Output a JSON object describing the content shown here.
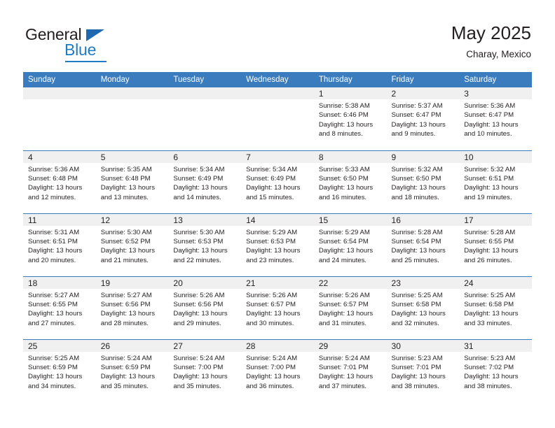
{
  "brand": {
    "name_part1": "General",
    "name_part2": "Blue"
  },
  "header": {
    "title": "May 2025",
    "subtitle": "Charay, Mexico"
  },
  "colors": {
    "header_blue": "#3b7cbf",
    "brand_blue": "#1f7bc4",
    "daynum_bg": "#f0f0f0",
    "text": "#231f20"
  },
  "weekdays": [
    "Sunday",
    "Monday",
    "Tuesday",
    "Wednesday",
    "Thursday",
    "Friday",
    "Saturday"
  ],
  "labels": {
    "sunrise_prefix": "Sunrise:",
    "sunset_prefix": "Sunset:",
    "daylight_prefix": "Daylight:"
  },
  "weeks": [
    [
      {
        "day": "",
        "empty": true
      },
      {
        "day": "",
        "empty": true
      },
      {
        "day": "",
        "empty": true
      },
      {
        "day": "",
        "empty": true
      },
      {
        "day": "1",
        "sunrise": "Sunrise: 5:38 AM",
        "sunset": "Sunset: 6:46 PM",
        "daylight": "Daylight: 13 hours and 8 minutes."
      },
      {
        "day": "2",
        "sunrise": "Sunrise: 5:37 AM",
        "sunset": "Sunset: 6:47 PM",
        "daylight": "Daylight: 13 hours and 9 minutes."
      },
      {
        "day": "3",
        "sunrise": "Sunrise: 5:36 AM",
        "sunset": "Sunset: 6:47 PM",
        "daylight": "Daylight: 13 hours and 10 minutes."
      }
    ],
    [
      {
        "day": "4",
        "sunrise": "Sunrise: 5:36 AM",
        "sunset": "Sunset: 6:48 PM",
        "daylight": "Daylight: 13 hours and 12 minutes."
      },
      {
        "day": "5",
        "sunrise": "Sunrise: 5:35 AM",
        "sunset": "Sunset: 6:48 PM",
        "daylight": "Daylight: 13 hours and 13 minutes."
      },
      {
        "day": "6",
        "sunrise": "Sunrise: 5:34 AM",
        "sunset": "Sunset: 6:49 PM",
        "daylight": "Daylight: 13 hours and 14 minutes."
      },
      {
        "day": "7",
        "sunrise": "Sunrise: 5:34 AM",
        "sunset": "Sunset: 6:49 PM",
        "daylight": "Daylight: 13 hours and 15 minutes."
      },
      {
        "day": "8",
        "sunrise": "Sunrise: 5:33 AM",
        "sunset": "Sunset: 6:50 PM",
        "daylight": "Daylight: 13 hours and 16 minutes."
      },
      {
        "day": "9",
        "sunrise": "Sunrise: 5:32 AM",
        "sunset": "Sunset: 6:50 PM",
        "daylight": "Daylight: 13 hours and 18 minutes."
      },
      {
        "day": "10",
        "sunrise": "Sunrise: 5:32 AM",
        "sunset": "Sunset: 6:51 PM",
        "daylight": "Daylight: 13 hours and 19 minutes."
      }
    ],
    [
      {
        "day": "11",
        "sunrise": "Sunrise: 5:31 AM",
        "sunset": "Sunset: 6:51 PM",
        "daylight": "Daylight: 13 hours and 20 minutes."
      },
      {
        "day": "12",
        "sunrise": "Sunrise: 5:30 AM",
        "sunset": "Sunset: 6:52 PM",
        "daylight": "Daylight: 13 hours and 21 minutes."
      },
      {
        "day": "13",
        "sunrise": "Sunrise: 5:30 AM",
        "sunset": "Sunset: 6:53 PM",
        "daylight": "Daylight: 13 hours and 22 minutes."
      },
      {
        "day": "14",
        "sunrise": "Sunrise: 5:29 AM",
        "sunset": "Sunset: 6:53 PM",
        "daylight": "Daylight: 13 hours and 23 minutes."
      },
      {
        "day": "15",
        "sunrise": "Sunrise: 5:29 AM",
        "sunset": "Sunset: 6:54 PM",
        "daylight": "Daylight: 13 hours and 24 minutes."
      },
      {
        "day": "16",
        "sunrise": "Sunrise: 5:28 AM",
        "sunset": "Sunset: 6:54 PM",
        "daylight": "Daylight: 13 hours and 25 minutes."
      },
      {
        "day": "17",
        "sunrise": "Sunrise: 5:28 AM",
        "sunset": "Sunset: 6:55 PM",
        "daylight": "Daylight: 13 hours and 26 minutes."
      }
    ],
    [
      {
        "day": "18",
        "sunrise": "Sunrise: 5:27 AM",
        "sunset": "Sunset: 6:55 PM",
        "daylight": "Daylight: 13 hours and 27 minutes."
      },
      {
        "day": "19",
        "sunrise": "Sunrise: 5:27 AM",
        "sunset": "Sunset: 6:56 PM",
        "daylight": "Daylight: 13 hours and 28 minutes."
      },
      {
        "day": "20",
        "sunrise": "Sunrise: 5:26 AM",
        "sunset": "Sunset: 6:56 PM",
        "daylight": "Daylight: 13 hours and 29 minutes."
      },
      {
        "day": "21",
        "sunrise": "Sunrise: 5:26 AM",
        "sunset": "Sunset: 6:57 PM",
        "daylight": "Daylight: 13 hours and 30 minutes."
      },
      {
        "day": "22",
        "sunrise": "Sunrise: 5:26 AM",
        "sunset": "Sunset: 6:57 PM",
        "daylight": "Daylight: 13 hours and 31 minutes."
      },
      {
        "day": "23",
        "sunrise": "Sunrise: 5:25 AM",
        "sunset": "Sunset: 6:58 PM",
        "daylight": "Daylight: 13 hours and 32 minutes."
      },
      {
        "day": "24",
        "sunrise": "Sunrise: 5:25 AM",
        "sunset": "Sunset: 6:58 PM",
        "daylight": "Daylight: 13 hours and 33 minutes."
      }
    ],
    [
      {
        "day": "25",
        "sunrise": "Sunrise: 5:25 AM",
        "sunset": "Sunset: 6:59 PM",
        "daylight": "Daylight: 13 hours and 34 minutes."
      },
      {
        "day": "26",
        "sunrise": "Sunrise: 5:24 AM",
        "sunset": "Sunset: 6:59 PM",
        "daylight": "Daylight: 13 hours and 35 minutes."
      },
      {
        "day": "27",
        "sunrise": "Sunrise: 5:24 AM",
        "sunset": "Sunset: 7:00 PM",
        "daylight": "Daylight: 13 hours and 35 minutes."
      },
      {
        "day": "28",
        "sunrise": "Sunrise: 5:24 AM",
        "sunset": "Sunset: 7:00 PM",
        "daylight": "Daylight: 13 hours and 36 minutes."
      },
      {
        "day": "29",
        "sunrise": "Sunrise: 5:24 AM",
        "sunset": "Sunset: 7:01 PM",
        "daylight": "Daylight: 13 hours and 37 minutes."
      },
      {
        "day": "30",
        "sunrise": "Sunrise: 5:23 AM",
        "sunset": "Sunset: 7:01 PM",
        "daylight": "Daylight: 13 hours and 38 minutes."
      },
      {
        "day": "31",
        "sunrise": "Sunrise: 5:23 AM",
        "sunset": "Sunset: 7:02 PM",
        "daylight": "Daylight: 13 hours and 38 minutes."
      }
    ]
  ]
}
